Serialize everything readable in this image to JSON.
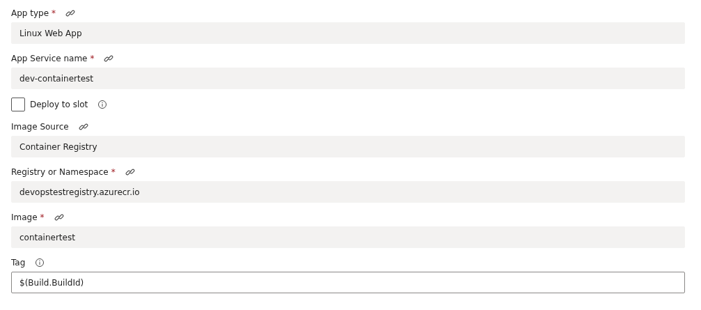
{
  "fields": [
    {
      "kind": "field",
      "label": "App type",
      "required_mark": "*",
      "linked": true,
      "info": false,
      "value": "Linux Web App",
      "disabled": true
    },
    {
      "kind": "field",
      "label": "App Service name",
      "required_mark": "*",
      "linked": true,
      "info": false,
      "value": "dev-containertest",
      "disabled": true
    },
    {
      "kind": "checkbox",
      "label": "Deploy to slot",
      "checked": false,
      "info": true
    },
    {
      "kind": "field",
      "label": "Image Source",
      "linked": true,
      "info": false,
      "value": "Container Registry",
      "disabled": true
    },
    {
      "kind": "field",
      "label": "Registry or Namespace",
      "required_mark": "*",
      "linked": true,
      "info": false,
      "value": "devopstestregistry.azurecr.io",
      "disabled": true
    },
    {
      "kind": "field",
      "label": "Image",
      "required_mark": "*",
      "linked": true,
      "info": false,
      "value": "containertest",
      "disabled": true
    },
    {
      "kind": "field",
      "label": "Tag",
      "linked": false,
      "info": true,
      "value": "$(Build.BuildId)",
      "disabled": false
    }
  ]
}
